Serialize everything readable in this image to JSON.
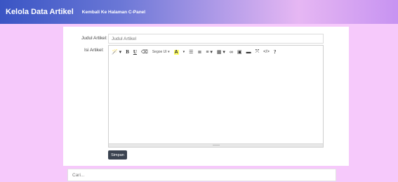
{
  "header": {
    "brand": "Kelola Data Artikel",
    "back_link": "Kembali Ke Halaman C-Panel"
  },
  "form": {
    "title_label": "Judul Artikel:",
    "title_placeholder": "Judul Artikel",
    "content_label": "Isi Artikel:",
    "save_label": "Simpan"
  },
  "toolbar": {
    "magic": "🪄 ▾",
    "bold": "B",
    "underline": "U",
    "eraser": "⌫",
    "font": "Segoe UI ▾",
    "color": "A",
    "color_caret": "▾",
    "ul": "☰",
    "ol": "≣",
    "align": "≡ ▾",
    "table": "▦ ▾",
    "link": "∞",
    "image": "▣",
    "video": "▬",
    "fullscreen": "⤧",
    "code": "</>",
    "help": "?"
  },
  "search": {
    "placeholder": "Cari..."
  },
  "colors": {
    "background": "#f6c9fb",
    "save_button": "#3b4350"
  }
}
